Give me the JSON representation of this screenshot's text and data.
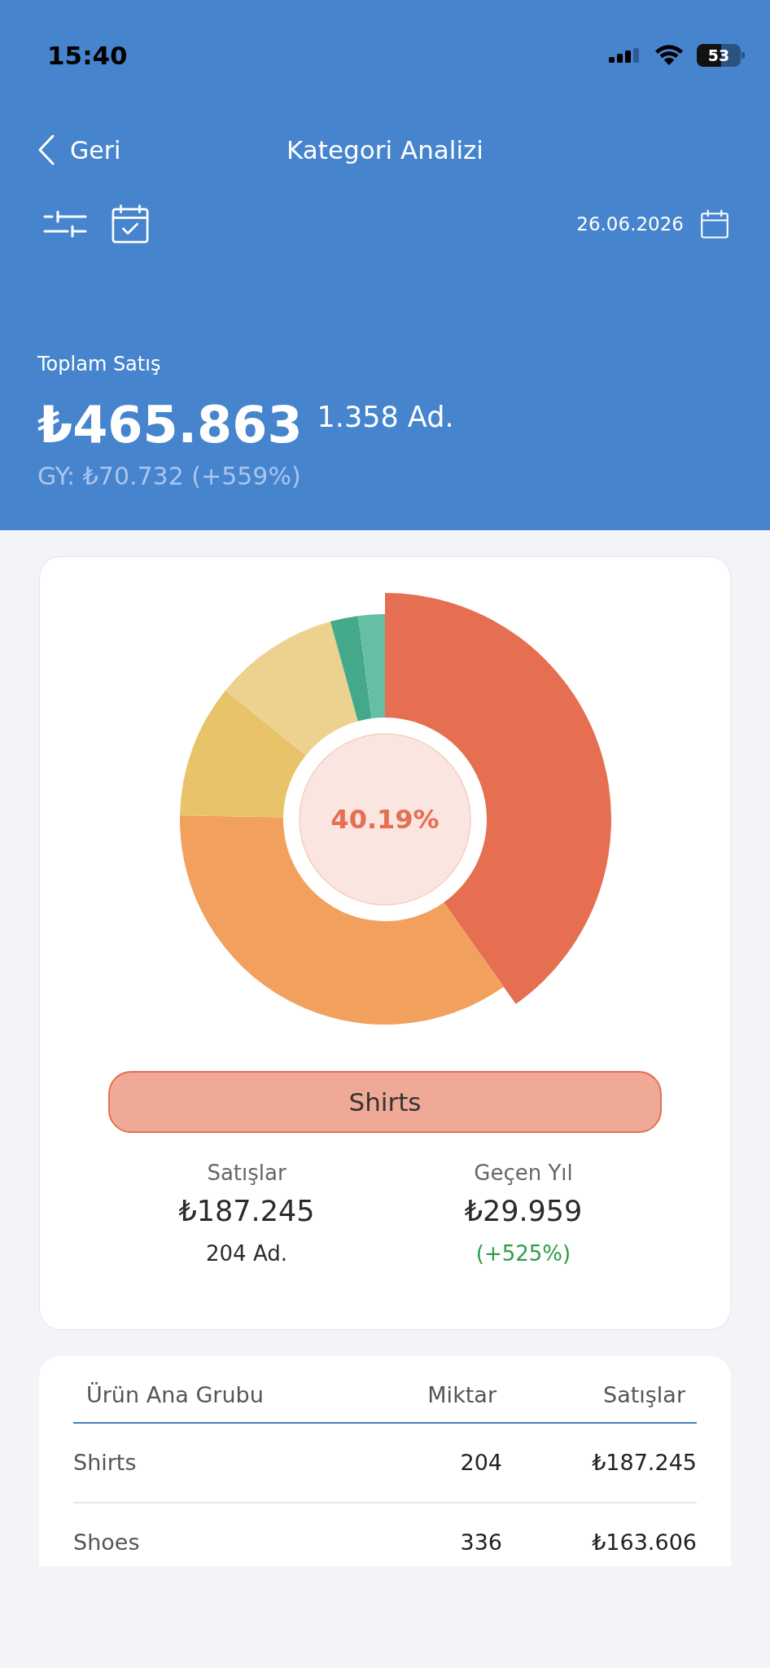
{
  "status_bar": {
    "time": "15:40",
    "battery": "53"
  },
  "nav": {
    "back_label": "Geri",
    "title": "Kategori Analizi"
  },
  "toolbar": {
    "date": "26.06.2026"
  },
  "summary": {
    "label": "Toplam Satış",
    "total": "₺465.863",
    "quantity": "1.358 Ad.",
    "previous_year": "GY: ₺70.732 (+559%)"
  },
  "chart": {
    "center_label": "40.19%",
    "segments": [
      {
        "color": "#e56f50",
        "selected": true
      },
      {
        "color": "#f2a05e",
        "selected": false
      },
      {
        "color": "#e8c36a",
        "selected": false
      },
      {
        "color": "#ecd28e",
        "selected": false
      },
      {
        "color": "#43a98a",
        "selected": false
      },
      {
        "color": "#66bfa5",
        "selected": false
      }
    ]
  },
  "selected_category": {
    "label": "Shirts"
  },
  "stats": [
    {
      "kind": "quantity",
      "label": "Satışlar",
      "value": "₺187.245",
      "detail": "204 Ad."
    },
    {
      "kind": "change",
      "label": "Geçen Yıl",
      "value": "₺29.959",
      "detail": "(+525%)"
    }
  ],
  "table": {
    "columns": [
      "Ürün Ana Grubu",
      "Miktar",
      "Satışlar"
    ],
    "rows": [
      [
        "Shirts",
        "204",
        "₺187.245"
      ],
      [
        "Shoes",
        "336",
        "₺163.606"
      ]
    ]
  }
}
